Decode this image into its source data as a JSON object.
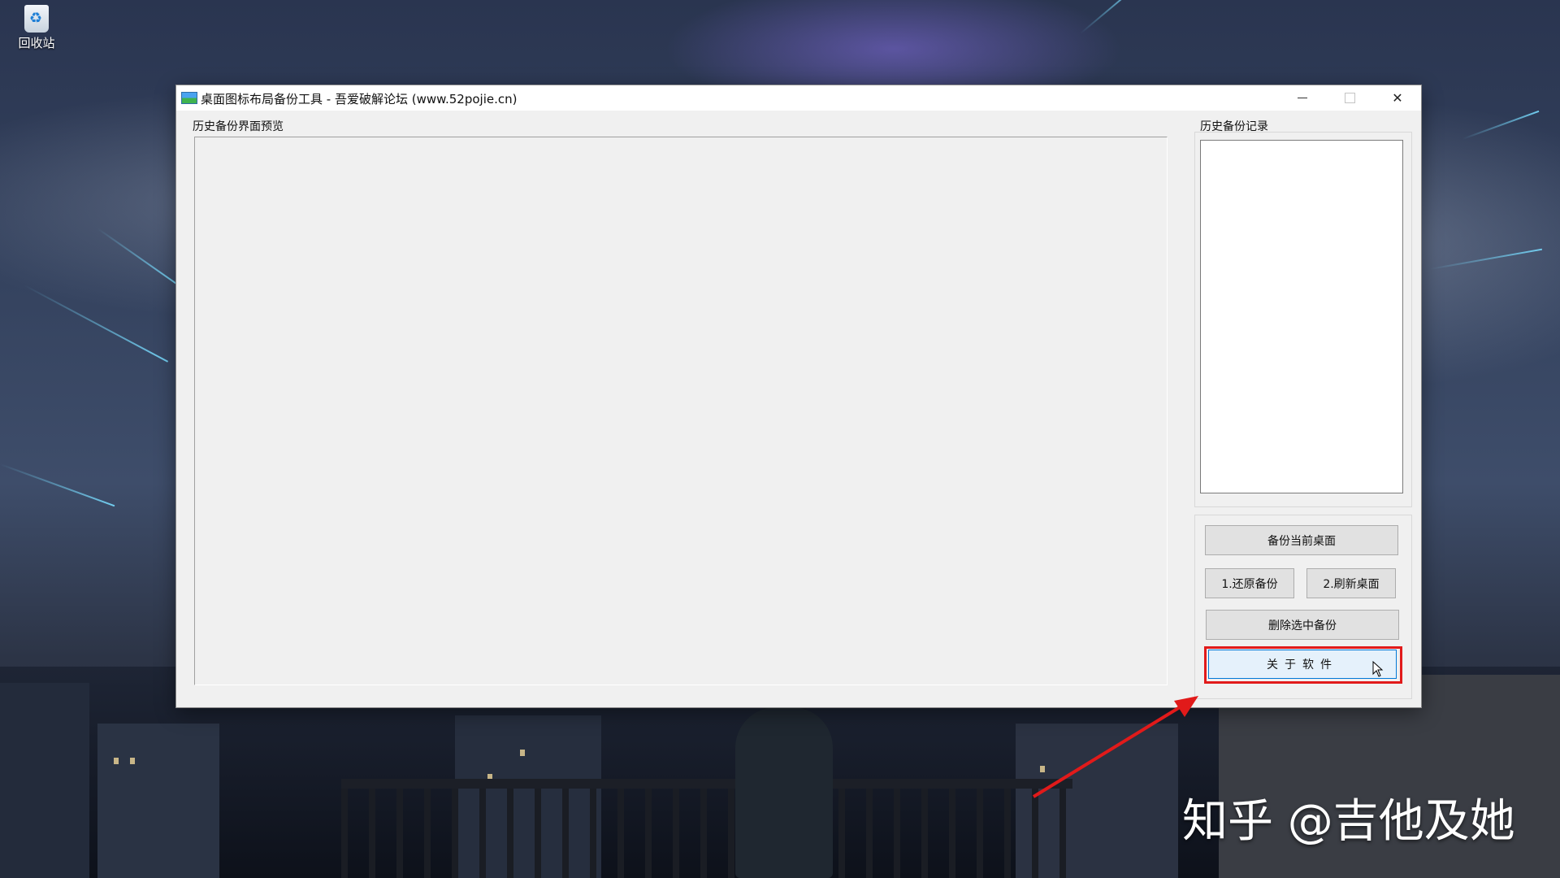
{
  "desktop": {
    "recycle_bin_label": "回收站",
    "watermark": "知乎 @吉他及她"
  },
  "window": {
    "title": "桌面图标布局备份工具 - 吾爱破解论坛 (www.52pojie.cn)",
    "icon": "app-icon",
    "caption_buttons": {
      "minimize_icon": "minimize-icon",
      "maximize_icon": "maximize-icon",
      "close_icon": "close-icon",
      "close_glyph": "✕"
    }
  },
  "preview": {
    "label": "历史备份界面预览"
  },
  "history": {
    "label": "历史备份记录",
    "items": []
  },
  "buttons": {
    "backup_current": "备份当前桌面",
    "restore": "1.还原备份",
    "refresh": "2.刷新桌面",
    "delete_selected": "删除选中备份",
    "about": "关于软件"
  },
  "annotation": {
    "highlight_color": "#e11a1a",
    "arrow_color": "#e11a1a"
  }
}
